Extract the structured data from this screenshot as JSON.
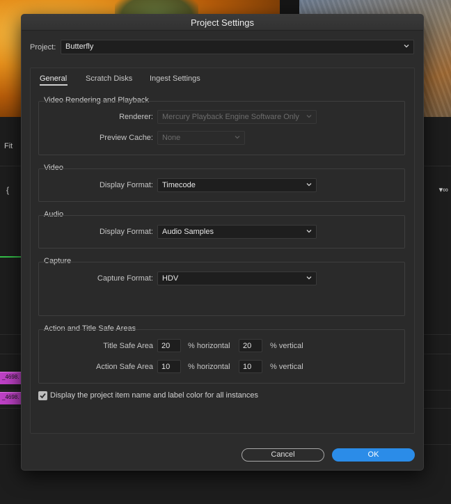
{
  "background": {
    "fit_label": "Fit",
    "clip_1_label": "_4698.",
    "clip_2_label": "_4698."
  },
  "dialog": {
    "title": "Project Settings",
    "project_label": "Project:",
    "project_value": "Butterfly",
    "tabs": [
      {
        "label": "General",
        "active": true
      },
      {
        "label": "Scratch Disks",
        "active": false
      },
      {
        "label": "Ingest Settings",
        "active": false
      }
    ],
    "video_rendering": {
      "title": "Video Rendering and Playback",
      "renderer_label": "Renderer:",
      "renderer_value": "Mercury Playback Engine Software Only",
      "preview_cache_label": "Preview Cache:",
      "preview_cache_value": "None"
    },
    "video": {
      "title": "Video",
      "display_format_label": "Display Format:",
      "display_format_value": "Timecode"
    },
    "audio": {
      "title": "Audio",
      "display_format_label": "Display Format:",
      "display_format_value": "Audio Samples"
    },
    "capture": {
      "title": "Capture",
      "capture_format_label": "Capture Format:",
      "capture_format_value": "HDV"
    },
    "safe_areas": {
      "title": "Action and Title Safe Areas",
      "title_safe_label": "Title Safe Area",
      "title_safe_h": "20",
      "title_safe_v": "20",
      "action_safe_label": "Action Safe Area",
      "action_safe_h": "10",
      "action_safe_v": "10",
      "horizontal_unit": "% horizontal",
      "vertical_unit": "% vertical"
    },
    "display_item_name_label": "Display the project item name and label color for all instances",
    "display_item_name_checked": true,
    "cancel_label": "Cancel",
    "ok_label": "OK"
  },
  "colors": {
    "accent": "#2b8ce8",
    "dialog_bg": "#2c2c2c"
  }
}
